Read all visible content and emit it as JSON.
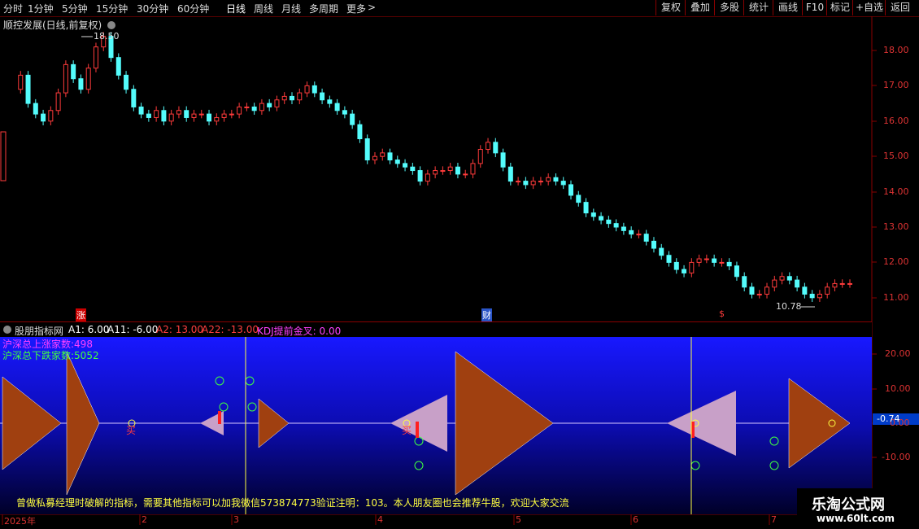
{
  "toolbar": {
    "periods": [
      "分时",
      "1分钟",
      "5分钟",
      "15分钟",
      "30分钟",
      "60分钟",
      "日线",
      "周线",
      "月线",
      "多周期",
      "更多"
    ],
    "more_arrow": ">",
    "right_buttons": [
      "复权",
      "叠加",
      "多股",
      "统计",
      "画线",
      "F10",
      "标记",
      "+自选",
      "返回"
    ]
  },
  "price_panel": {
    "title": "顺控发展(日线,前复权)",
    "high_label": "18.50",
    "low_label": "10.78",
    "y_ticks": [
      "18.00",
      "17.00",
      "16.00",
      "15.00",
      "14.00",
      "13.00",
      "12.00",
      "11.00"
    ],
    "event_marks": [
      "涨",
      "财",
      "$"
    ]
  },
  "indicator": {
    "name": "股朋指标网",
    "a1": "A1: 6.00",
    "a11": "A11: -6.00",
    "a2": "A2: 13.00",
    "a22": "A22: -13.00",
    "kdj": "KDJ提前金叉: 0.00",
    "up_count": "沪深总上涨家数:498",
    "down_count": "沪深总下跌家数:5052",
    "y_ticks": [
      "20.00",
      "10.00",
      "0.00",
      "-10.00"
    ],
    "current_value": "-0.74",
    "buy_label": "买",
    "footer_text": "曾做私募经理时破解的指标，需要其他指标可以加我微信573874773验证注明：103。本人朋友圈也会推荐牛股，欢迎大家交流"
  },
  "date_axis": {
    "labels": [
      "2025年",
      "2",
      "3",
      "4",
      "5",
      "6",
      "7"
    ]
  },
  "right_edge_text": "",
  "watermark": {
    "line1": "乐淘公式网",
    "line2": "www.60lt.com"
  },
  "colors": {
    "up": "#ff3b3b",
    "down": "#54fcfc",
    "grid_red": "#8a0000",
    "indicator_bg_top": "#1212ff",
    "indicator_bg_bottom": "#000033",
    "brown": "#a04010",
    "magenta": "#ff40ff",
    "yellow": "#ffff40",
    "green": "#40ff40"
  }
}
